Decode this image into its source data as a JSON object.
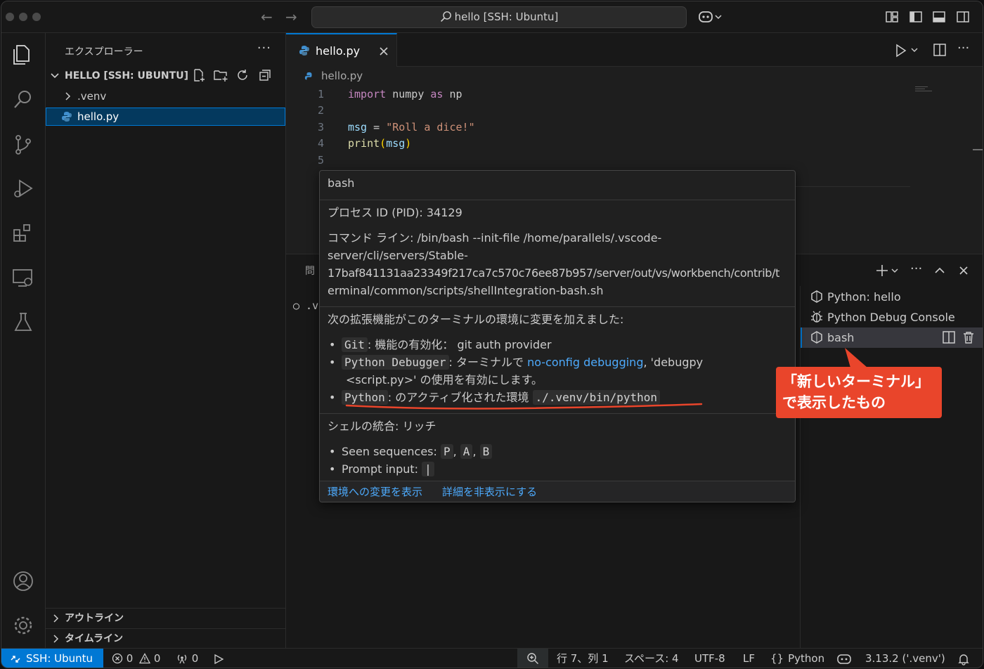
{
  "window": {
    "search_text": "hello [SSH: Ubuntu]"
  },
  "sidebar": {
    "title": "エクスプローラー",
    "more": "···",
    "section": "HELLO [SSH: UBUNTU]",
    "items": [
      {
        "label": ".venv"
      },
      {
        "label": "hello.py"
      }
    ],
    "outline": "アウトライン",
    "timeline": "タイムライン"
  },
  "editor": {
    "tab_label": "hello.py",
    "breadcrumb": "hello.py",
    "lines": [
      {
        "num": "1"
      },
      {
        "num": "2"
      },
      {
        "num": "3"
      },
      {
        "num": "4"
      },
      {
        "num": "5"
      }
    ],
    "code": {
      "import": "import",
      "numpy": " numpy ",
      "as": "as",
      "np": " np",
      "msg": "msg",
      "eq": " = ",
      "str": "\"Roll a dice!\"",
      "print": "print",
      "lpar": "(",
      "arg": "msg",
      "rpar": ")"
    }
  },
  "panel": {
    "tab_partial": "問",
    "term_partial": "○ .v",
    "terminals": [
      {
        "label": "Python: hello"
      },
      {
        "label": "Python Debug Console"
      },
      {
        "label": "bash"
      }
    ]
  },
  "hover": {
    "title": "bash",
    "pid": "プロセス ID (PID): 34129",
    "cmd_lines": [
      "コマンド ライン: /bin/bash --init-file /home/parallels/.vscode-",
      "server/cli/servers/Stable-",
      "17baf841131aa23349f217ca7c570c76ee87b957/server/out/vs/workbench/contrib/t",
      "erminal/common/scripts/shellIntegration-bash.sh"
    ],
    "ext_heading": "次の拡張機能がこのターミナルの環境に変更を加えました:",
    "ext1_code": "Git",
    "ext1_text": ": 機能の有効化： git auth provider",
    "ext2_code": "Python Debugger",
    "ext2_text": ": ターミナルで ",
    "ext2_link": "no-config debugging",
    "ext2_text2": ", 'debugpy",
    "ext2_line2": "<script.py>' の使用を有効にします。",
    "ext3_code": "Python",
    "ext3_text": ": のアクティブ化された環境 ",
    "ext3_code2": "./.venv/bin/python",
    "shell_heading": "シェルの統合: リッチ",
    "seen_label": "Seen sequences: ",
    "seq": [
      "P",
      "A",
      "B"
    ],
    "prompt_label": "Prompt input: ",
    "prompt_val": "|",
    "footer_link1": "環境への変更を表示",
    "footer_link2": "詳細を非表示にする"
  },
  "callout": {
    "line1": "「新しいターミナル」",
    "line2": "で表示したもの"
  },
  "statusbar": {
    "remote": "SSH: Ubuntu",
    "errors": "0",
    "warnings": "0",
    "ports": "0",
    "position": "行 7、列 1",
    "spaces": "スペース: 4",
    "encoding": "UTF-8",
    "eol": "LF",
    "language": "Python",
    "interpreter": "3.13.2 ('.venv')"
  },
  "colors": {
    "accent": "#0078d4",
    "callout": "#e9452b",
    "underline": "#e9452b"
  }
}
